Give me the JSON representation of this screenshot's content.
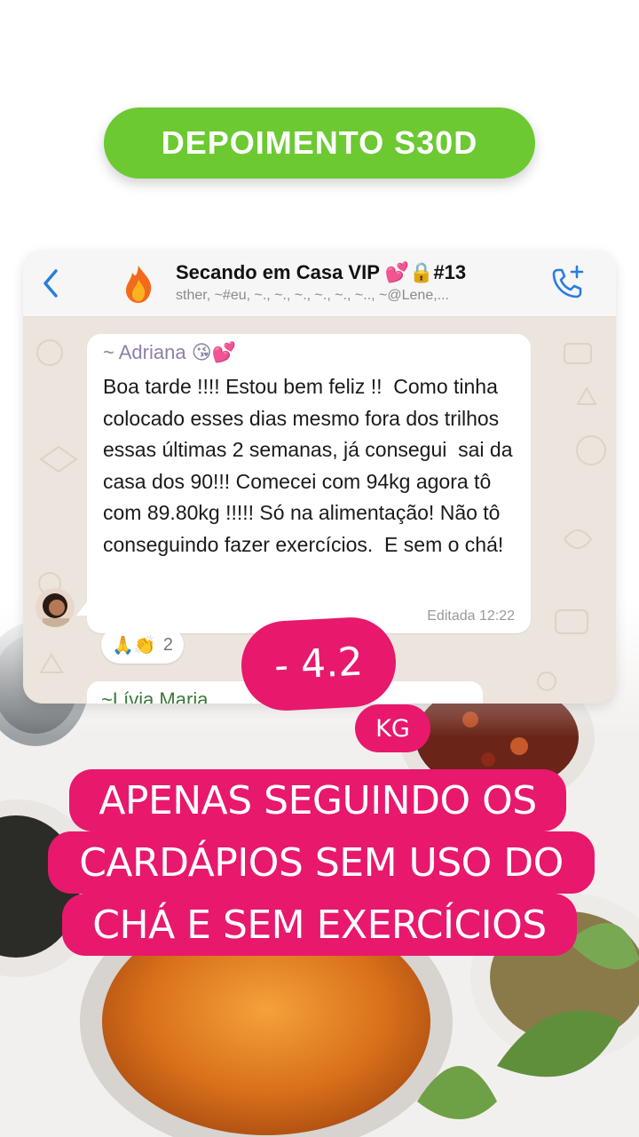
{
  "header": {
    "title": "DEPOIMENTO S30D"
  },
  "chat": {
    "group_name": "Secando em Casa VIP 💕🔒#13",
    "members": "sther, ~#eu, ~., ~., ~., ~., ~., ~.., ~@Lene,...",
    "avatar_emoji": "🔥",
    "message": {
      "sender": "~ Adriana 😘💕",
      "text": "Boa tarde !!!! Estou bem feliz !!  Como tinha colocado esses dias mesmo fora dos trilhos essas últimas 2 semanas, já consegui  sai da casa dos 90!!! Comecei com 94kg agora tô com 89.80kg !!!!! Só na alimentação! Não tô conseguindo fazer exercícios.  E sem o chá!",
      "edited_label": "Editada 12:22",
      "reactions": "🙏👏",
      "reaction_count": "2"
    },
    "next_sender": "~Lívia Maria"
  },
  "result": {
    "weight_loss": "- 4.2",
    "unit": "KG"
  },
  "caption": {
    "line1": "APENAS SEGUINDO OS",
    "line2": "CARDÁPIOS SEM USO DO",
    "line3": "CHÁ E SEM EXERCÍCIOS"
  },
  "colors": {
    "title_pill": "#6cc932",
    "accent_pink": "#e8186d",
    "ios_blue": "#2a7de1",
    "chat_wallpaper": "#ece5dd"
  }
}
